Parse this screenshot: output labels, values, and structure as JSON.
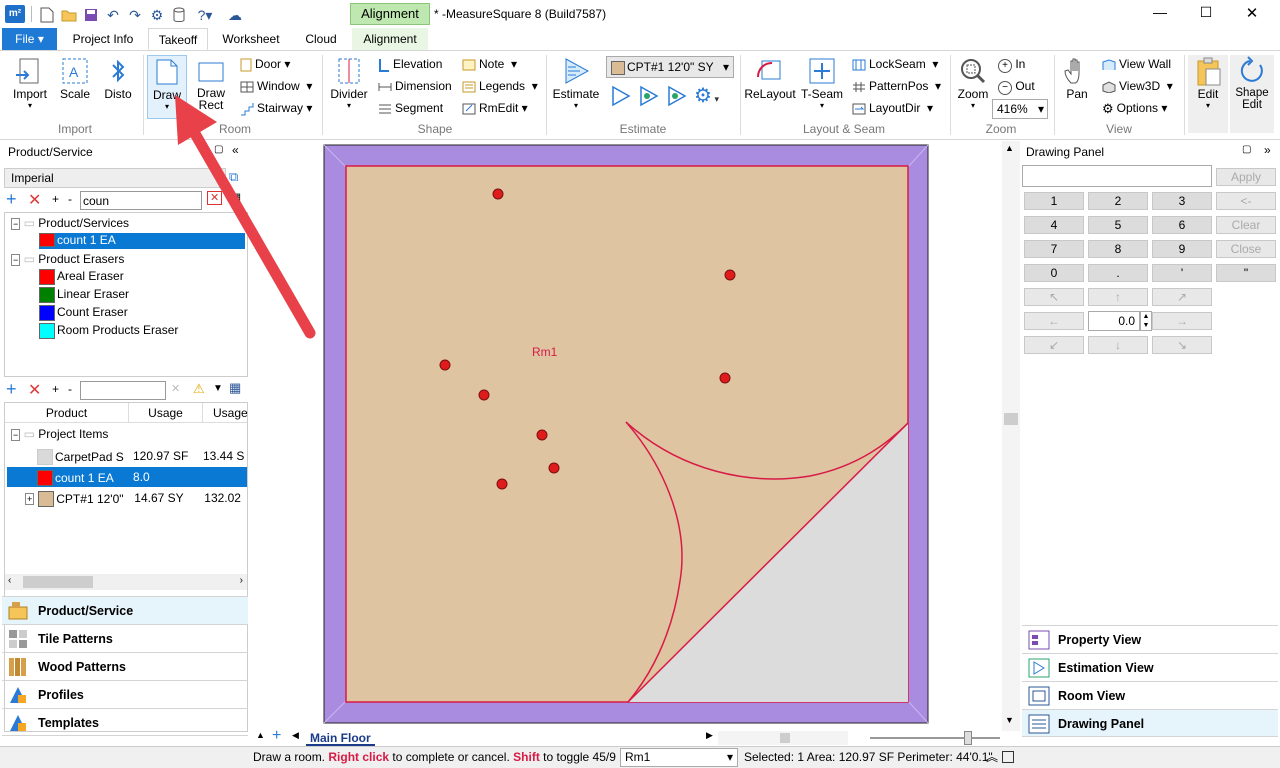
{
  "window": {
    "title": "* -MeasureSquare 8 (Build7587)",
    "context_tab": "Alignment"
  },
  "tabs": {
    "file": "File",
    "items": [
      "Project Info",
      "Takeoff",
      "Worksheet",
      "Cloud",
      "Alignment"
    ],
    "active": "Takeoff"
  },
  "ribbon": {
    "import": "Import",
    "scale": "Scale",
    "disto": "Disto",
    "draw": "Draw",
    "draw_rect": "Draw Rect",
    "door": "Door",
    "window": "Window",
    "stairway": "Stairway",
    "divider": "Divider",
    "elevation": "Elevation",
    "dimension": "Dimension",
    "segment": "Segment",
    "note": "Note",
    "legends": "Legends",
    "rmedit": "RmEdit",
    "product_select": "CPT#1 12'0\" SY",
    "estimate": "Estimate",
    "relayout": "ReLayout",
    "tseam": "T-Seam",
    "lockseam": "LockSeam",
    "patternpos": "PatternPos",
    "layoutdir": "LayoutDir",
    "zoom": "Zoom",
    "zoom_in": "In",
    "zoom_out": "Out",
    "zoom_level": "416%",
    "pan": "Pan",
    "view_wall": "View Wall",
    "view3d": "View3D",
    "options": "Options",
    "edit": "Edit",
    "shape_edit": "Shape Edit",
    "groups": {
      "import": "Import",
      "room": "Room",
      "shape": "Shape",
      "estimate": "Estimate",
      "layout": "Layout & Seam",
      "zoom": "Zoom",
      "view": "View"
    }
  },
  "left_panel": {
    "header": "Product/Service",
    "unit": "Imperial",
    "search": "coun",
    "tree1": {
      "group1": "Product/Services",
      "item1": "count 1  EA",
      "group2": "Product Erasers",
      "erasers": [
        {
          "label": "Areal Eraser",
          "color": "#ff0000"
        },
        {
          "label": "Linear Eraser",
          "color": "#008000"
        },
        {
          "label": "Count Eraser",
          "color": "#0000ff"
        },
        {
          "label": "Room Products Eraser",
          "color": "#00ffff"
        }
      ]
    },
    "table": {
      "cols": [
        "Product",
        "Usage",
        "Usage"
      ],
      "group": "Project Items",
      "rows": [
        {
          "name": "CarpetPad  S",
          "u1": "120.97 SF",
          "u2": "13.44 S",
          "color": "#d9d9d9"
        },
        {
          "name": "count 1  EA",
          "u1": "8.0",
          "u2": "",
          "color": "#ff0000"
        },
        {
          "name": "CPT#1 12'0\"",
          "u1": "14.67 SY",
          "u2": "132.02",
          "color": "#d9bc96"
        }
      ]
    },
    "nav": [
      "Product/Service",
      "Tile Patterns",
      "Wood Patterns",
      "Profiles",
      "Templates"
    ]
  },
  "canvas": {
    "room_label": "Rm1",
    "floor_tab": "Main Floor"
  },
  "right_panel": {
    "header": "Drawing Panel",
    "apply": "Apply",
    "keys": [
      "1",
      "2",
      "3",
      "<-",
      "4",
      "5",
      "6",
      "Clear",
      "7",
      "8",
      "9",
      "Close",
      "0",
      ".",
      "'",
      "\""
    ],
    "angle": "0.0",
    "nav": [
      "Property View",
      "Estimation View",
      "Room View",
      "Drawing Panel"
    ]
  },
  "status": {
    "hint_pre": "Draw a room.",
    "right_click": "Right click",
    "hint_mid": "to complete or cancel.",
    "shift": "Shift",
    "hint_post": "to toggle 45/9",
    "room": "Rm1",
    "summary": "Selected: 1 Area: 120.97 SF Perimeter: 44'0.1\""
  },
  "colors": {
    "accent": "#0a79d4",
    "room_fill": "#dfc4a2",
    "room_border": "#d81b45",
    "wall": "#a98be0",
    "arrow": "#e8414a"
  }
}
